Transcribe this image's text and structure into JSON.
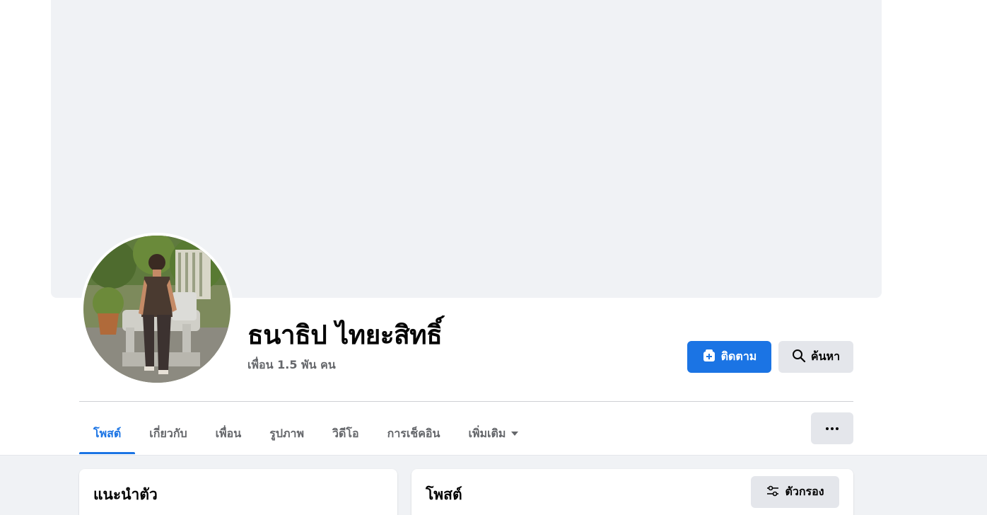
{
  "profile": {
    "name": "ธนาธิป ไทยะสิทธิ์",
    "friends": "เพื่อน 1.5 พัน คน"
  },
  "actions": {
    "follow_label": "ติดตาม",
    "search_label": "ค้นหา"
  },
  "tabs": [
    {
      "label": "โพสต์",
      "active": true
    },
    {
      "label": "เกี่ยวกับ",
      "active": false
    },
    {
      "label": "เพื่อน",
      "active": false
    },
    {
      "label": "รูปภาพ",
      "active": false
    },
    {
      "label": "วิดีโอ",
      "active": false
    },
    {
      "label": "การเช็คอิน",
      "active": false
    },
    {
      "label": "เพิ่มเติม",
      "active": false
    }
  ],
  "intro": {
    "title": "แนะนำตัว"
  },
  "posts": {
    "title": "โพสต์",
    "filter_label": "ตัวกรอง"
  },
  "icons": {
    "follow": "follow-add-icon",
    "search": "search-icon",
    "more": "more-dots-icon",
    "filter": "filter-sliders-icon",
    "dropdown": "caret-down-icon"
  },
  "colors": {
    "accent": "#1b74e4",
    "secondary_button": "#e4e6eb",
    "cover_placeholder": "#f0f2f5",
    "muted_text": "#65676b"
  }
}
